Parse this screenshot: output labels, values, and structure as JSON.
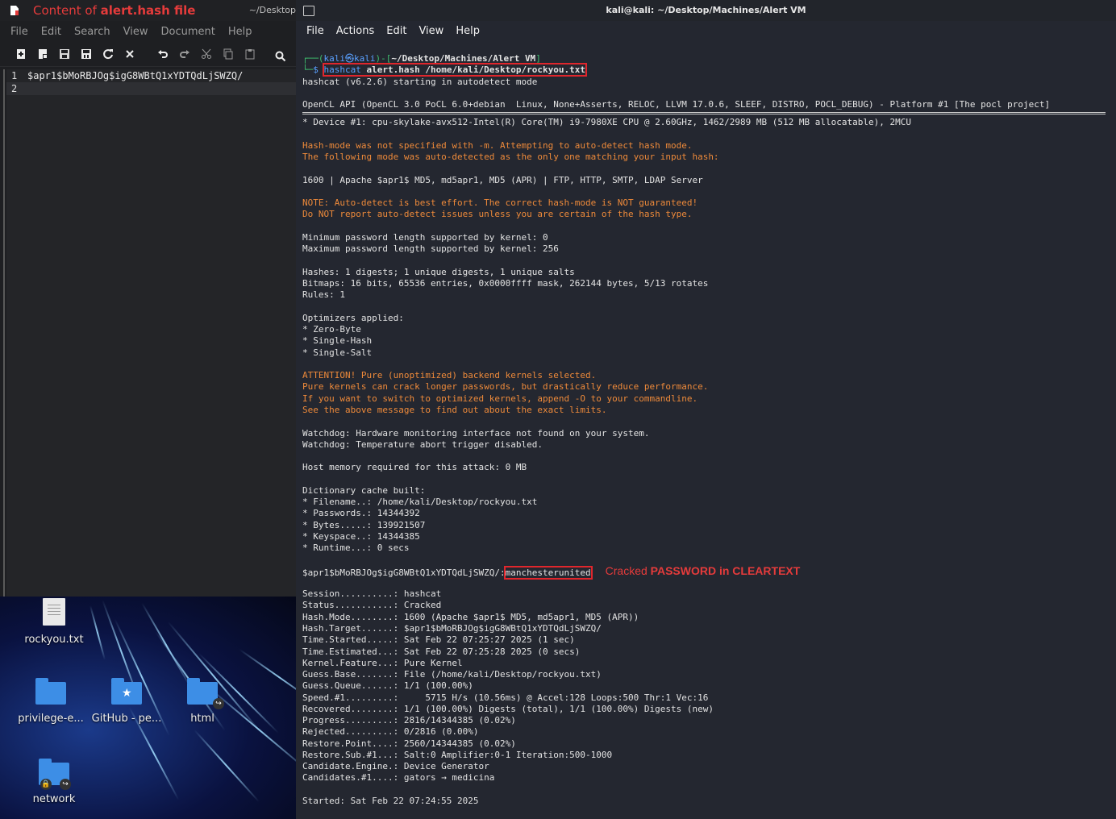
{
  "editor": {
    "title_prefix": "Content of ",
    "title_bold": "alert.hash file",
    "path": "~/Desktop",
    "menu": [
      "File",
      "Edit",
      "Search",
      "View",
      "Document",
      "Help"
    ],
    "lines": [
      {
        "num": "1",
        "text": "$apr1$bMoRBJOg$igG8WBtQ1xYDTQdLjSWZQ/"
      },
      {
        "num": "2",
        "text": ""
      }
    ]
  },
  "desktop": {
    "icons": [
      "rockyou.txt",
      "privilege-e...",
      "GitHub - pe...",
      "html",
      "network"
    ]
  },
  "terminal": {
    "title": "kali@kali: ~/Desktop/Machines/Alert VM",
    "menu": [
      "File",
      "Actions",
      "Edit",
      "View",
      "Help"
    ],
    "prompt_user": "kali",
    "prompt_at": "㉿",
    "prompt_host": "kali",
    "prompt_dir": "~/Desktop/Machines/Alert VM",
    "cmd_name": "hashcat",
    "cmd_args": " alert.hash /home/kali/Desktop/rockyou.txt",
    "lines_a": [
      "hashcat (v6.2.6) starting in autodetect mode",
      "",
      "OpenCL API (OpenCL 3.0 PoCL 6.0+debian  Linux, None+Asserts, RELOC, LLVM 17.0.6, SLEEF, DISTRO, POCL_DEBUG) - Platform #1 [The pocl project]"
    ],
    "device_line": "* Device #1: cpu-skylake-avx512-Intel(R) Core(TM) i9-7980XE CPU @ 2.60GHz, 1462/2989 MB (512 MB allocatable), 2MCU",
    "warn1": [
      "Hash-mode was not specified with -m. Attempting to auto-detect hash mode.",
      "The following mode was auto-detected as the only one matching your input hash:"
    ],
    "mode_line": "1600 | Apache $apr1$ MD5, md5apr1, MD5 (APR) | FTP, HTTP, SMTP, LDAP Server",
    "warn2": [
      "NOTE: Auto-detect is best effort. The correct hash-mode is NOT guaranteed!",
      "Do NOT report auto-detect issues unless you are certain of the hash type."
    ],
    "lines_b": [
      "Minimum password length supported by kernel: 0",
      "Maximum password length supported by kernel: 256",
      "",
      "Hashes: 1 digests; 1 unique digests, 1 unique salts",
      "Bitmaps: 16 bits, 65536 entries, 0x0000ffff mask, 262144 bytes, 5/13 rotates",
      "Rules: 1",
      "",
      "Optimizers applied:",
      "* Zero-Byte",
      "* Single-Hash",
      "* Single-Salt"
    ],
    "warn3": [
      "ATTENTION! Pure (unoptimized) backend kernels selected.",
      "Pure kernels can crack longer passwords, but drastically reduce performance.",
      "If you want to switch to optimized kernels, append -O to your commandline.",
      "See the above message to find out about the exact limits."
    ],
    "lines_c": [
      "Watchdog: Hardware monitoring interface not found on your system.",
      "Watchdog: Temperature abort trigger disabled.",
      "",
      "Host memory required for this attack: 0 MB",
      "",
      "Dictionary cache built:",
      "* Filename..: /home/kali/Desktop/rockyou.txt",
      "* Passwords.: 14344392",
      "* Bytes.....: 139921507",
      "* Keyspace..: 14344385",
      "* Runtime...: 0 secs"
    ],
    "cracked_hash": "$apr1$bMoRBJOg$igG8WBtQ1xYDTQdLjSWZQ/:",
    "cracked_pass": "manchesterunited",
    "callout_plain": "Cracked ",
    "callout_bold": "PASSWORD in CLEARTEXT",
    "lines_d": [
      "Session..........: hashcat",
      "Status...........: Cracked",
      "Hash.Mode........: 1600 (Apache $apr1$ MD5, md5apr1, MD5 (APR))",
      "Hash.Target......: $apr1$bMoRBJOg$igG8WBtQ1xYDTQdLjSWZQ/",
      "Time.Started.....: Sat Feb 22 07:25:27 2025 (1 sec)",
      "Time.Estimated...: Sat Feb 22 07:25:28 2025 (0 secs)",
      "Kernel.Feature...: Pure Kernel",
      "Guess.Base.......: File (/home/kali/Desktop/rockyou.txt)",
      "Guess.Queue......: 1/1 (100.00%)",
      "Speed.#1.........:     5715 H/s (10.56ms) @ Accel:128 Loops:500 Thr:1 Vec:16",
      "Recovered........: 1/1 (100.00%) Digests (total), 1/1 (100.00%) Digests (new)",
      "Progress.........: 2816/14344385 (0.02%)",
      "Rejected.........: 0/2816 (0.00%)",
      "Restore.Point....: 2560/14344385 (0.02%)",
      "Restore.Sub.#1...: Salt:0 Amplifier:0-1 Iteration:500-1000",
      "Candidate.Engine.: Device Generator",
      "Candidates.#1....: gators → medicina",
      "",
      "Started: Sat Feb 22 07:24:55 2025"
    ]
  }
}
